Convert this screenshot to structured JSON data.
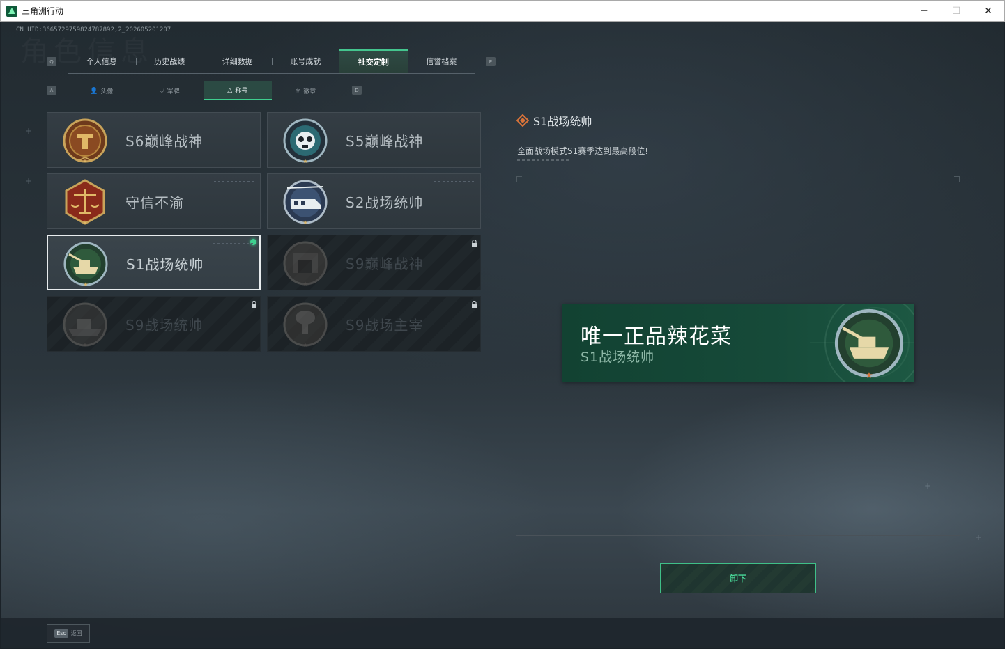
{
  "window": {
    "title": "三角洲行动",
    "minimize": "─",
    "maximize": "☐",
    "close": "✕"
  },
  "uid_text": "CN UID:3665729759824787892,2_202605201207",
  "background_title": "角色信息",
  "keyhints": {
    "prev_main": "Q",
    "next_main": "E",
    "prev_sub": "A",
    "next_sub": "D"
  },
  "main_tabs": [
    {
      "label": "个人信息",
      "active": false
    },
    {
      "label": "历史战绩",
      "active": false
    },
    {
      "label": "详细数据",
      "active": false
    },
    {
      "label": "账号成就",
      "active": false
    },
    {
      "label": "社交定制",
      "active": true
    },
    {
      "label": "信誉档案",
      "active": false
    }
  ],
  "sub_tabs": [
    {
      "label": "头像",
      "icon": "person-icon",
      "glyph": "👤",
      "active": false
    },
    {
      "label": "军牌",
      "icon": "dogtag-icon",
      "glyph": "⛉",
      "active": false
    },
    {
      "label": "称号",
      "icon": "triangle-icon",
      "glyph": "△",
      "active": true
    },
    {
      "label": "徽章",
      "icon": "wings-icon",
      "glyph": "⚜",
      "active": false
    }
  ],
  "titles": [
    {
      "label": "S6巅峰战神",
      "badge": "shield-badge-icon",
      "state": "unlocked"
    },
    {
      "label": "S5巅峰战神",
      "badge": "skull-badge-icon",
      "state": "unlocked"
    },
    {
      "label": "守信不渝",
      "badge": "scales-badge-icon",
      "state": "unlocked"
    },
    {
      "label": "S2战场统帅",
      "badge": "helicopter-badge-icon",
      "state": "unlocked"
    },
    {
      "label": "S1战场统帅",
      "badge": "tank-badge-icon",
      "state": "selected"
    },
    {
      "label": "S9巅峰战神",
      "badge": "fortress-badge-icon",
      "state": "locked"
    },
    {
      "label": "S9战场统帅",
      "badge": "warship-badge-icon",
      "state": "locked"
    },
    {
      "label": "S9战场主宰",
      "badge": "mushroom-cloud-badge-icon",
      "state": "locked"
    }
  ],
  "detail": {
    "title": "S1战场统帅",
    "description": "全面战场模式S1赛季达到最高段位!"
  },
  "nameplate": {
    "player_name": "唯一正品辣花菜",
    "title": "S1战场统帅"
  },
  "unequip_button": "卸下",
  "bottom": {
    "esc_key": "Esc",
    "back_label": "返回"
  },
  "colors": {
    "accent_green": "#3fd08f",
    "nameplate_green": "#164a39",
    "badge_gold": "#c8a35a",
    "badge_bronze": "#b86a2c"
  }
}
